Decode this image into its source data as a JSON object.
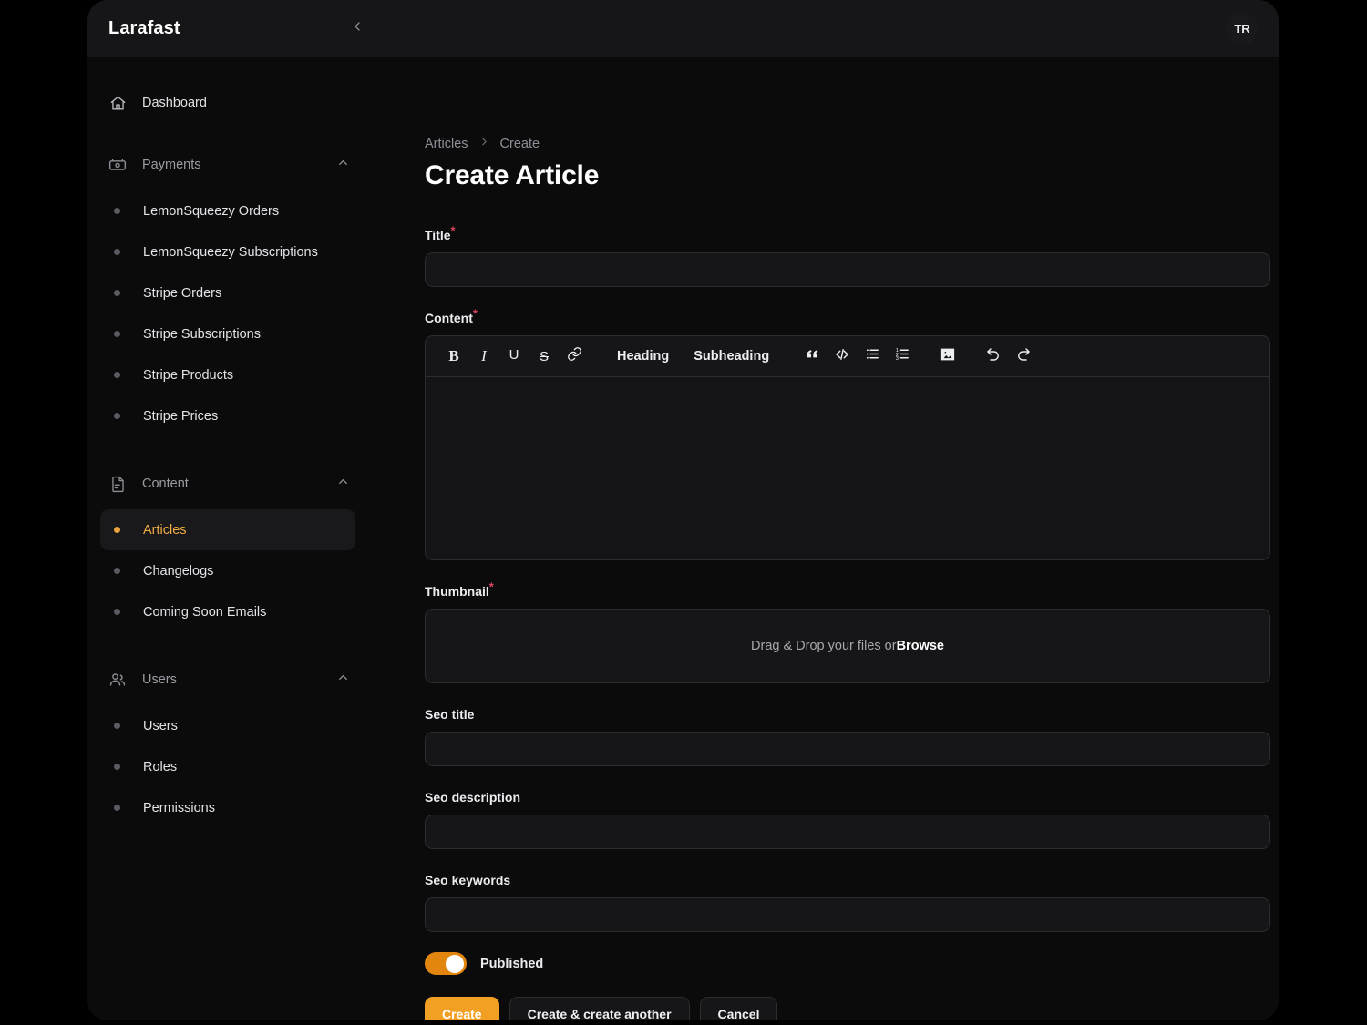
{
  "window": {
    "brand": "Larafast",
    "avatar_initials": "TR",
    "accent_orange": "#f2a024",
    "toggle_orange": "#e28610",
    "active_text": "#eeab42",
    "required_color": "#d9455f",
    "surface": "#161618",
    "background": "#0b0b0c"
  },
  "sidebar": {
    "dashboard": {
      "label": "Dashboard",
      "icon": "home-icon"
    },
    "groups": [
      {
        "label": "Payments",
        "icon": "banknote-icon",
        "chevron": "chevron-up-icon",
        "items": [
          {
            "label": "LemonSqueezy Orders",
            "active": false
          },
          {
            "label": "LemonSqueezy Subscriptions",
            "active": false
          },
          {
            "label": "Stripe Orders",
            "active": false
          },
          {
            "label": "Stripe Subscriptions",
            "active": false
          },
          {
            "label": "Stripe Products",
            "active": false
          },
          {
            "label": "Stripe Prices",
            "active": false
          }
        ]
      },
      {
        "label": "Content",
        "icon": "document-icon",
        "chevron": "chevron-up-icon",
        "items": [
          {
            "label": "Articles",
            "active": true
          },
          {
            "label": "Changelogs",
            "active": false
          },
          {
            "label": "Coming Soon Emails",
            "active": false
          }
        ]
      },
      {
        "label": "Users",
        "icon": "users-icon",
        "chevron": "chevron-up-icon",
        "items": [
          {
            "label": "Users",
            "active": false
          },
          {
            "label": "Roles",
            "active": false
          },
          {
            "label": "Permissions",
            "active": false
          }
        ]
      }
    ]
  },
  "main": {
    "breadcrumb": {
      "parent": "Articles",
      "current": "Create"
    },
    "page_title": "Create Article",
    "fields": {
      "title": {
        "label": "Title",
        "required": true,
        "value": "",
        "placeholder": ""
      },
      "content": {
        "label": "Content",
        "required": true,
        "value": ""
      },
      "thumbnail": {
        "label": "Thumbnail",
        "required": true,
        "drop_text": "Drag & Drop your files or ",
        "browse_label": "Browse"
      },
      "seo_title": {
        "label": "Seo title",
        "required": false,
        "value": "",
        "placeholder": ""
      },
      "seo_description": {
        "label": "Seo description",
        "required": false,
        "value": "",
        "placeholder": ""
      },
      "seo_keywords": {
        "label": "Seo keywords",
        "required": false,
        "value": "",
        "placeholder": ""
      }
    },
    "editor_toolbar": [
      {
        "name": "bold",
        "glyph": "B",
        "type": "glyph"
      },
      {
        "name": "italic",
        "glyph": "I",
        "type": "glyph"
      },
      {
        "name": "underline",
        "glyph": "U",
        "type": "glyph"
      },
      {
        "name": "strikethrough",
        "glyph": "S",
        "type": "glyph"
      },
      {
        "name": "link",
        "glyph": "link-icon",
        "type": "icon"
      },
      {
        "name": "heading",
        "glyph": "Heading",
        "type": "text"
      },
      {
        "name": "subheading",
        "glyph": "Subheading",
        "type": "text"
      },
      {
        "name": "blockquote",
        "glyph": "quote-icon",
        "type": "icon"
      },
      {
        "name": "code-block",
        "glyph": "code-icon",
        "type": "icon"
      },
      {
        "name": "bullet-list",
        "glyph": "bullet-list-icon",
        "type": "icon"
      },
      {
        "name": "ordered-list",
        "glyph": "ordered-list-icon",
        "type": "icon"
      },
      {
        "name": "insert-image",
        "glyph": "image-icon",
        "type": "icon"
      },
      {
        "name": "undo",
        "glyph": "undo-icon",
        "type": "icon"
      },
      {
        "name": "redo",
        "glyph": "redo-icon",
        "type": "icon"
      }
    ],
    "toolbar_labels": {
      "heading": "Heading",
      "subheading": "Subheading",
      "bold": "B",
      "italic": "I",
      "underline": "U",
      "strikethrough": "S"
    },
    "published_toggle": {
      "label": "Published",
      "on": true
    },
    "actions": {
      "create": "Create",
      "create_another": "Create & create another",
      "cancel": "Cancel"
    }
  }
}
